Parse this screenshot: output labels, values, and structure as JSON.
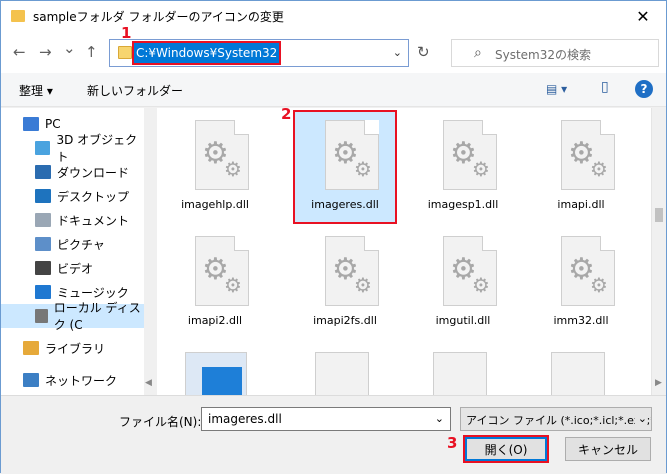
{
  "titlebar": {
    "title": "sampleフォルダ フォルダーのアイコンの変更",
    "close": "✕"
  },
  "address": {
    "path": "C:¥Windows¥System32",
    "search_placeholder": "System32の検索"
  },
  "nav": {
    "back": "←",
    "forward": "→",
    "up_history": "⌄",
    "up": "↑",
    "refresh": "↻",
    "chevron": "⌄"
  },
  "toolbar": {
    "organize": "整理 ▾",
    "new_folder": "新しいフォルダー",
    "view": "▤ ▾",
    "preview": "▯",
    "help": "?"
  },
  "badges": {
    "one": "1",
    "two": "2",
    "three": "3"
  },
  "sidebar": {
    "items": [
      {
        "label": "PC",
        "icon": "pc-icon",
        "color": "#3a7bd5"
      },
      {
        "label": "3D オブジェクト",
        "icon": "3d-objects-icon",
        "color": "#4aa3df"
      },
      {
        "label": "ダウンロード",
        "icon": "download-icon",
        "color": "#2b6cb0"
      },
      {
        "label": "デスクトップ",
        "icon": "desktop-icon",
        "color": "#1e73be"
      },
      {
        "label": "ドキュメント",
        "icon": "documents-icon",
        "color": "#9aa7b5"
      },
      {
        "label": "ピクチャ",
        "icon": "pictures-icon",
        "color": "#5d8fc9"
      },
      {
        "label": "ビデオ",
        "icon": "videos-icon",
        "color": "#444444"
      },
      {
        "label": "ミュージック",
        "icon": "music-icon",
        "color": "#1f78d1"
      },
      {
        "label": "ローカル ディスク (C",
        "icon": "local-disk-icon",
        "color": "#777777"
      },
      {
        "label": "ライブラリ",
        "icon": "libraries-icon",
        "color": "#e6a93a"
      },
      {
        "label": "ネットワーク",
        "icon": "network-icon",
        "color": "#3c7fc4"
      }
    ]
  },
  "files": [
    "imagehlp.dll",
    "imageres.dll",
    "imagesp1.dll",
    "imapi.dll",
    "imapi2.dll",
    "imapi2fs.dll",
    "imgutil.dll",
    "imm32.dll"
  ],
  "bottom": {
    "filename_label": "ファイル名(N):",
    "filename_value": "imageres.dll",
    "filter_value": "アイコン ファイル (*.ico;*.icl;*.exe;*.dll)",
    "open_label": "開く(O)",
    "cancel_label": "キャンセル"
  }
}
